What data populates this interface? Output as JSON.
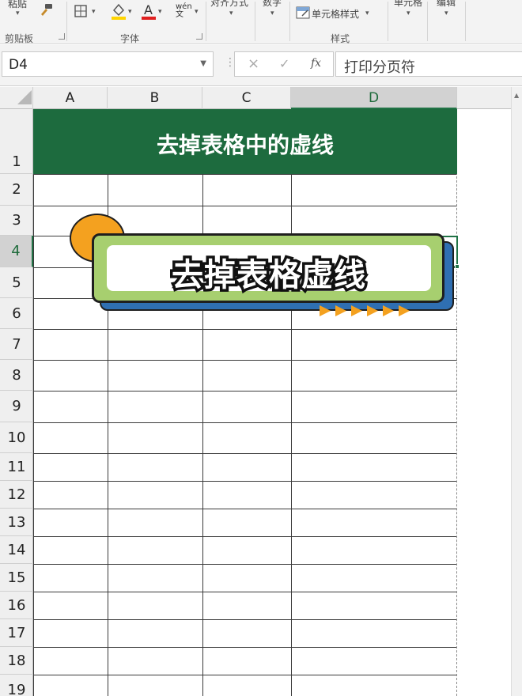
{
  "ribbon": {
    "paste_label": "粘贴",
    "clipboard_group": "剪贴板",
    "font_group": "字体",
    "align_label": "对齐方式",
    "number_label": "数字",
    "cell_style_label": "单元格样式",
    "styles_group": "样式",
    "cells_label": "单元格",
    "edit_label": "编辑",
    "wen_icon_text": "wén"
  },
  "formula_bar": {
    "name_box": "D4",
    "cancel_glyph": "×",
    "enter_glyph": "✓",
    "fx_glyph": "fx",
    "content": "打印分页符"
  },
  "sheet": {
    "columns": [
      "A",
      "B",
      "C",
      "D"
    ],
    "selected_column": "D",
    "rows": [
      "1",
      "2",
      "3",
      "4",
      "5",
      "6",
      "7",
      "8",
      "9",
      "10",
      "11",
      "12",
      "13",
      "14",
      "15",
      "16",
      "17",
      "18",
      "19"
    ],
    "selected_row": "4",
    "banner_title": "去掉表格中的虚线"
  },
  "overlay": {
    "title": "去掉表格虚线"
  },
  "colors": {
    "banner_green": "#1d6b3e",
    "selection_green": "#217346",
    "card_green": "#a7cf6f",
    "card_blue": "#2f6fb2",
    "accent_orange": "#f4a11f"
  }
}
